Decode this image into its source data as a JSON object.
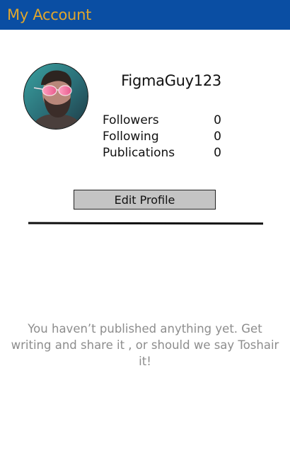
{
  "app_bar": {
    "title": "My Account",
    "background_color": "#0a4ea3",
    "title_color": "#e1a62c"
  },
  "profile": {
    "username": "FigmaGuy123",
    "avatar_icon": "user-avatar-photo",
    "stats": [
      {
        "label": "Followers",
        "value": "0"
      },
      {
        "label": "Following",
        "value": "0"
      },
      {
        "label": "Publications",
        "value": "0"
      }
    ],
    "edit_button_label": "Edit Profile"
  },
  "publications": {
    "empty_message": "You haven’t published anything yet. Get writing and share it , or should we say Toshair it!"
  }
}
